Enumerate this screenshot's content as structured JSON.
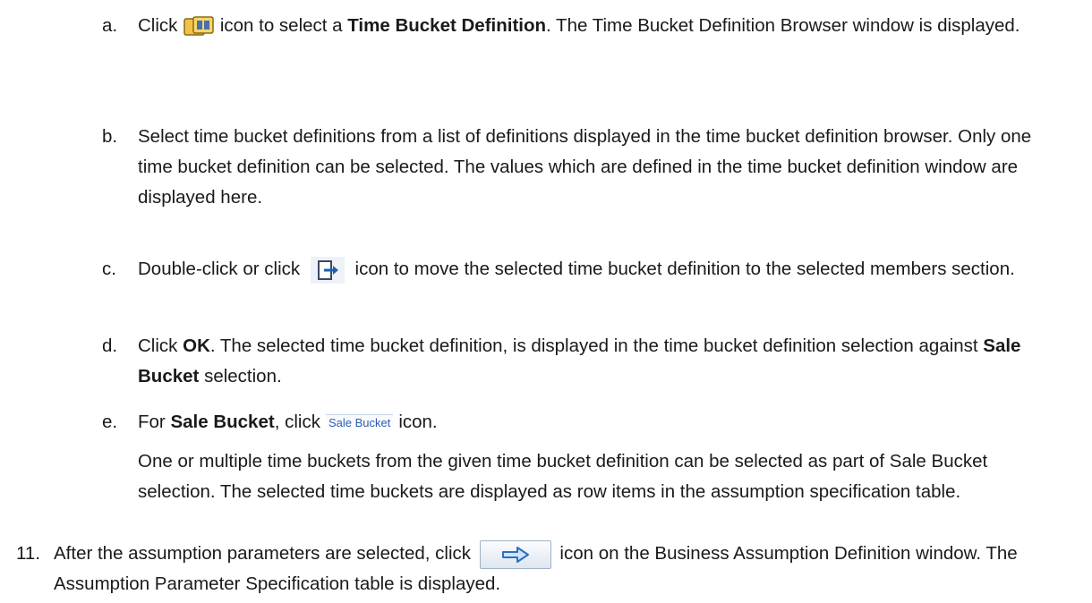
{
  "steps": {
    "a": {
      "letter": "a.",
      "pre": "Click",
      "mid": "icon to select a",
      "bold": "Time Bucket Definition",
      "post": ". The Time Bucket Definition Browser window is displayed."
    },
    "b": {
      "letter": "b.",
      "text": "Select time bucket definitions from a list of definitions displayed in the time bucket definition browser. Only one time bucket definition can be selected. The values which are defined in the time bucket definition window are displayed here."
    },
    "c": {
      "letter": "c.",
      "pre": "Double-click or click",
      "post": "icon to move the selected time bucket definition to the selected members section."
    },
    "d": {
      "letter": "d.",
      "pre": "Click",
      "bold1": "OK",
      "mid": ". The selected time bucket definition, is displayed in the time bucket definition selection against",
      "bold2": "Sale Bucket",
      "post": "selection."
    },
    "e": {
      "letter": "e.",
      "pre": "For",
      "bold": "Sale Bucket",
      "mid": ", click",
      "button_label": "Sale Bucket",
      "post": "icon.",
      "para": "One or multiple time buckets from the given time bucket definition can be selected as part of Sale Bucket selection. The selected time buckets are displayed as row items in the assumption specification table."
    }
  },
  "step11": {
    "num": "11.",
    "pre": "After the assumption parameters are selected, click",
    "post": "icon on the Business Assumption Definition window. The Assumption Parameter Specification table is displayed."
  },
  "icons": {
    "browser": "time-bucket-browser-icon",
    "move": "move-selected-icon",
    "next": "next-arrow-icon"
  }
}
